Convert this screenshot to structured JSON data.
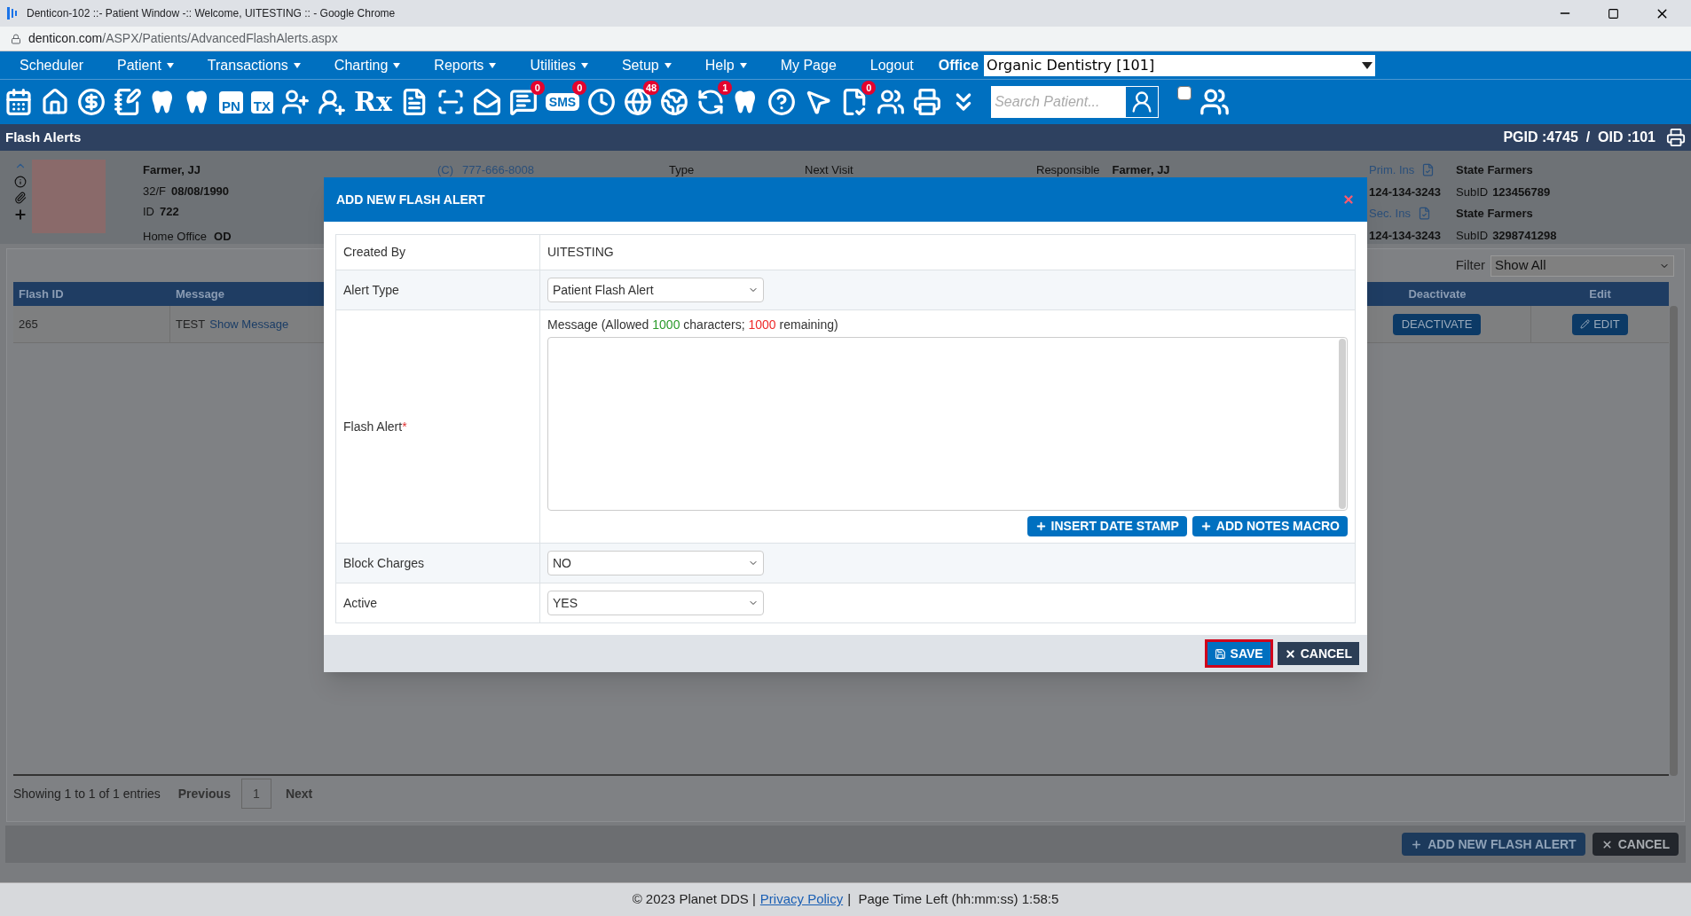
{
  "browser": {
    "title": "Denticon-102 ::- Patient Window -:: Welcome, UITESTING :: - Google Chrome",
    "url_host": "denticon.com",
    "url_path": "/ASPX/Patients/AdvancedFlashAlerts.aspx"
  },
  "menu": [
    {
      "label": "Scheduler",
      "dropdown": false
    },
    {
      "label": "Patient",
      "dropdown": true
    },
    {
      "label": "Transactions",
      "dropdown": true
    },
    {
      "label": "Charting",
      "dropdown": true
    },
    {
      "label": "Reports",
      "dropdown": true
    },
    {
      "label": "Utilities",
      "dropdown": true
    },
    {
      "label": "Setup",
      "dropdown": true
    },
    {
      "label": "Help",
      "dropdown": true
    },
    {
      "label": "My Page",
      "dropdown": false
    },
    {
      "label": "Logout",
      "dropdown": false
    }
  ],
  "office": {
    "label": "Office",
    "value": "Organic Dentistry [101]"
  },
  "toolbar": {
    "labels": [
      "PN",
      "TX",
      "Rx",
      "SMS"
    ],
    "badges": [
      "0",
      "0",
      "48",
      "1",
      "0"
    ],
    "search_placeholder": "Search Patient...",
    "checkbox_checked": false
  },
  "page_bar": {
    "title": "Flash Alerts",
    "ids": "PGID :4745  /  OID :101"
  },
  "patient": {
    "name": "Farmer, JJ",
    "age_sex": "32/F",
    "dob": "08/08/1990",
    "id_label": "ID",
    "id": "722",
    "office_label": "Home Office",
    "office": "OD",
    "phone_type": "(C)",
    "phone": "777-666-8008",
    "type_label": "Type",
    "next_visit_label": "Next Visit",
    "responsible_label": "Responsible",
    "responsible": "Farmer, JJ",
    "insurances": [
      {
        "label": "Prim. Ins",
        "carrier": "State Farmers",
        "phone": "124-134-3243",
        "subid_label": "SubID",
        "subid": "123456789"
      },
      {
        "label": "Sec. Ins",
        "carrier": "State Farmers",
        "phone": "124-134-3243",
        "subid_label": "SubID",
        "subid": "3298741298"
      }
    ]
  },
  "table": {
    "filter_label": "Filter",
    "filter_value": "Show All",
    "columns": [
      "Flash ID",
      "Message",
      "Deactivate",
      "Edit"
    ],
    "rows": [
      {
        "id": "265",
        "message": "TEST",
        "link": "Show Message",
        "deactivate": "DEACTIVATE",
        "edit": "EDIT"
      }
    ]
  },
  "pagination": {
    "info": "Showing 1 to 1 of 1 entries",
    "previous": "Previous",
    "pages": [
      "1"
    ],
    "next": "Next"
  },
  "actions": [
    "ADD NEW FLASH ALERT",
    "CANCEL"
  ],
  "footer": {
    "copyright": "© 2023 Planet DDS |",
    "link": "Privacy Policy",
    "time": "|  Page Time Left (hh:mm:ss) 1:58:5"
  },
  "dialog": {
    "title": "ADD NEW FLASH ALERT",
    "rows": [
      {
        "kind": "text",
        "label": "Created By",
        "value": "UITESTING"
      },
      {
        "kind": "select",
        "label": "Alert Type",
        "value": "Patient Flash Alert"
      },
      {
        "kind": "message",
        "label": "Flash Alert",
        "required_mark": "*",
        "counter": {
          "prefix": "Message (Allowed",
          "allowed": "1000",
          "middle": "characters;",
          "remaining": "1000",
          "suffix": "remaining)"
        },
        "buttons": [
          "INSERT DATE STAMP",
          "ADD NOTES MACRO"
        ]
      },
      {
        "kind": "select",
        "label": "Block Charges",
        "value": "NO"
      },
      {
        "kind": "select",
        "label": "Active",
        "value": "YES"
      }
    ],
    "buttons": [
      {
        "kind": "save",
        "label": "SAVE",
        "focused": true
      },
      {
        "kind": "cancel",
        "label": "CANCEL",
        "focused": false
      }
    ]
  }
}
